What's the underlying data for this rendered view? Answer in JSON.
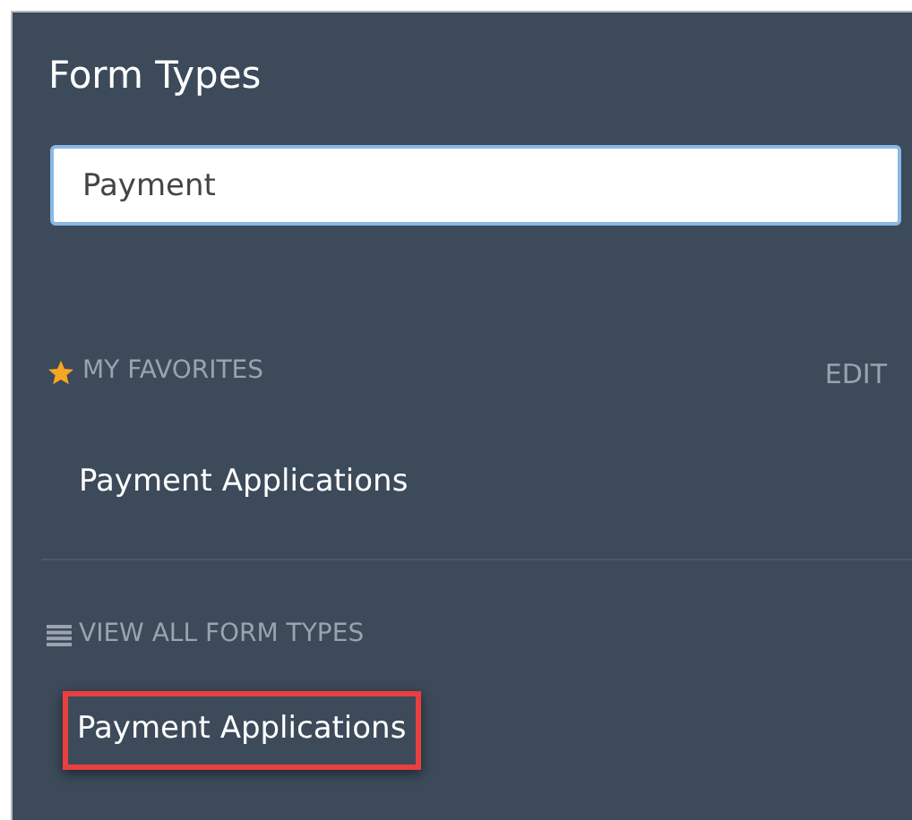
{
  "title": "Form Types",
  "search": {
    "value": "Payment"
  },
  "favorites": {
    "heading": "MY FAVORITES",
    "action": "EDIT",
    "items": [
      {
        "label": "Payment Applications",
        "highlighted": false
      }
    ]
  },
  "all_types": {
    "heading": "VIEW ALL FORM TYPES",
    "items": [
      {
        "label": "Payment Applications",
        "highlighted": true
      }
    ]
  }
}
